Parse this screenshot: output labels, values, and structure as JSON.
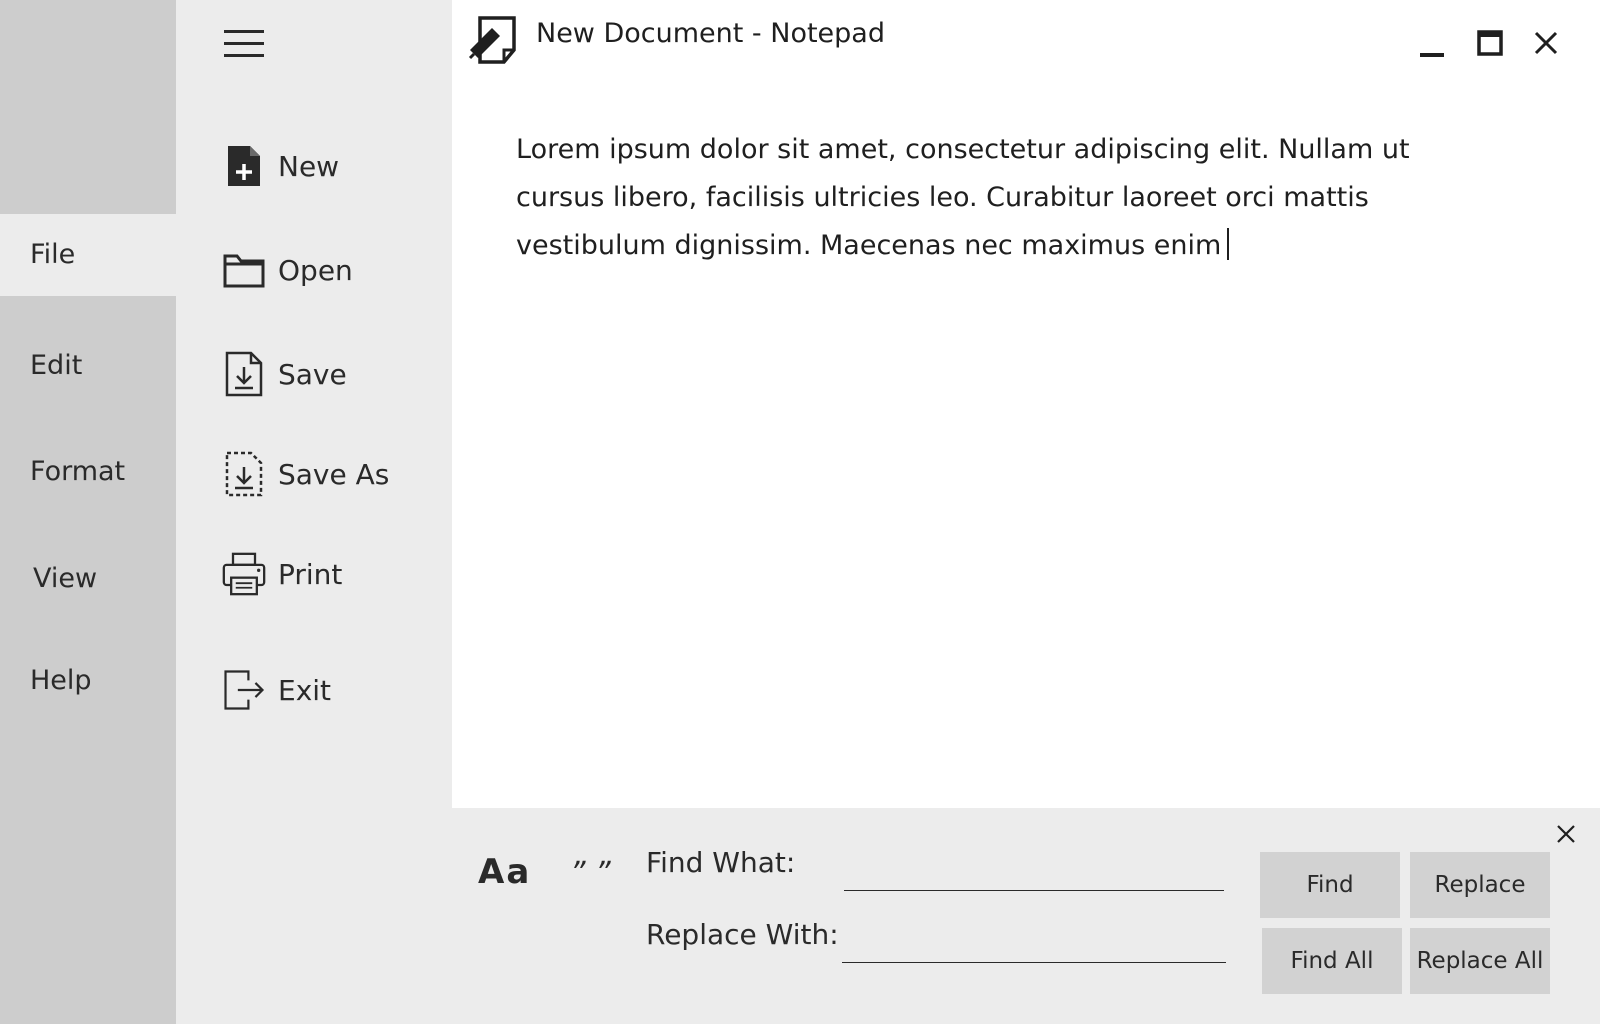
{
  "window": {
    "title": "New Document - Notepad"
  },
  "menu": {
    "items": [
      {
        "label": "File",
        "active": true
      },
      {
        "label": "Edit",
        "active": false
      },
      {
        "label": "Format",
        "active": false
      },
      {
        "label": "View",
        "active": false
      },
      {
        "label": "Help",
        "active": false
      }
    ]
  },
  "file_menu": {
    "items": [
      {
        "label": "New",
        "icon": "new-file-icon"
      },
      {
        "label": "Open",
        "icon": "folder-icon"
      },
      {
        "label": "Save",
        "icon": "save-icon"
      },
      {
        "label": "Save As",
        "icon": "save-as-icon"
      },
      {
        "label": "Print",
        "icon": "printer-icon"
      },
      {
        "label": "Exit",
        "icon": "exit-icon"
      }
    ]
  },
  "editor": {
    "content": "Lorem ipsum dolor sit amet, consectetur adipiscing elit. Nullam ut cursus libero, facilisis ultricies leo. Curabitur laoreet orci mattis vestibulum dignissim. Maecenas nec maximus enim"
  },
  "find_replace": {
    "match_case_label": "Aa",
    "whole_word_label": "” ”",
    "find_label": "Find What:",
    "find_value": "",
    "replace_label": "Replace With:",
    "replace_value": "",
    "buttons": {
      "find": "Find",
      "replace": "Replace",
      "find_all": "Find All",
      "replace_all": "Replace All"
    }
  },
  "colors": {
    "rail_bg": "#cdcdcd",
    "panel_bg": "#ececec",
    "button_bg": "#d2d2d2",
    "text": "#2a2a2a"
  }
}
